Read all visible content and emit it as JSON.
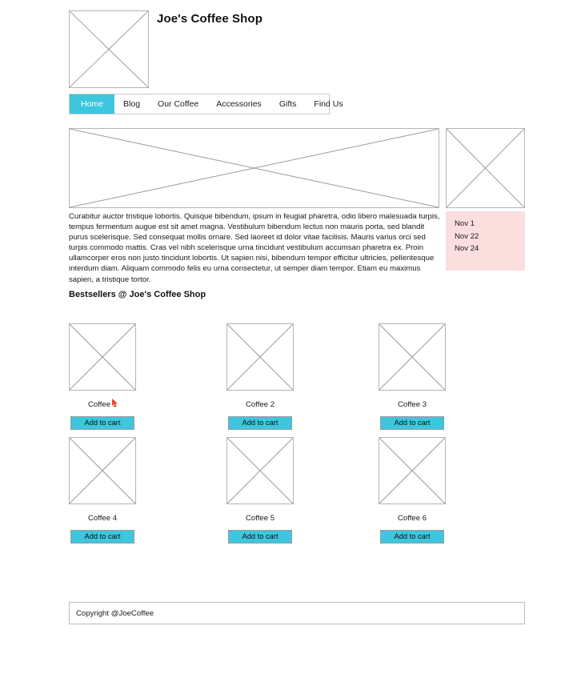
{
  "header": {
    "site_title": "Joe's Coffee Shop",
    "logo_alt": "logo-placeholder"
  },
  "nav": {
    "items": [
      {
        "label": "Home",
        "active": true
      },
      {
        "label": "Blog",
        "active": false
      },
      {
        "label": "Our Coffee",
        "active": false
      },
      {
        "label": "Accessories",
        "active": false
      },
      {
        "label": "Gifts",
        "active": false
      },
      {
        "label": "Find Us",
        "active": false
      }
    ],
    "active_bg": "#3dc6dd"
  },
  "hero": {
    "banner_alt": "hero-banner-placeholder",
    "side_image_alt": "side-image-placeholder"
  },
  "body": {
    "paragraph": "Curabitur auctor tristique lobortis. Quisque bibendum, ipsum in feugiat pharetra, odio libero malesuada turpis, tempus fermentum augue est sit amet magna. Vestibulum bibendum lectus non mauris porta, sed blandit purus scelerisque. Sed consequat mollis ornare. Sed laoreet id dolor vitae facilisis. Mauris varius orci sed turpis commodo mattis. Cras vel nibh scelerisque urna tincidunt vestibulum accumsan pharetra ex. Proin ullamcorper eros non justo tincidunt lobortis. Ut sapien nisi, bibendum tempor efficitur ultricies, pellentesque interdum diam. Aliquam commodo felis eu urna consectetur, ut semper diam tempor. Etiam eu maximus sapien, a tristique tortor."
  },
  "dates_panel": {
    "background": "#fbdede",
    "dates": [
      "Nov 1",
      "Nov 22",
      "Nov 24"
    ]
  },
  "bestsellers": {
    "heading": "Bestsellers @ Joe's Coffee Shop",
    "button_label": "Add to cart",
    "button_color": "#3dc6dd",
    "products": [
      {
        "name": "Coffee 1",
        "image_alt": "product-image-placeholder"
      },
      {
        "name": "Coffee 2",
        "image_alt": "product-image-placeholder"
      },
      {
        "name": "Coffee 3",
        "image_alt": "product-image-placeholder"
      },
      {
        "name": "Coffee 4",
        "image_alt": "product-image-placeholder"
      },
      {
        "name": "Coffee 5",
        "image_alt": "product-image-placeholder"
      },
      {
        "name": "Coffee 6",
        "image_alt": "product-image-placeholder"
      }
    ]
  },
  "cursor": {
    "name": "mouse-cursor",
    "color": "#e8452c"
  },
  "footer": {
    "copyright": "Copyright @JoeCoffee"
  }
}
